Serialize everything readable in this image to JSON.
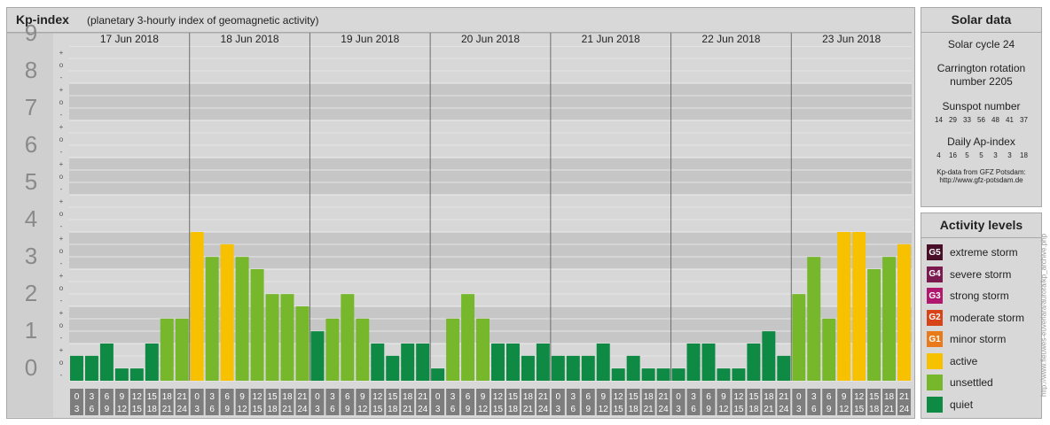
{
  "kp_panel": {
    "title": "Kp-index",
    "subtitle": "(planetary 3-hourly index of geomagnetic activity)"
  },
  "chart_data": {
    "type": "bar",
    "ylim": [
      0,
      9
    ],
    "y_ticks": [
      "0",
      "1",
      "2",
      "3",
      "4",
      "5",
      "6",
      "7",
      "8",
      "9"
    ],
    "minor_ticks": [
      "-",
      "o",
      "+"
    ],
    "days": [
      "17 Jun 2018",
      "18 Jun 2018",
      "19 Jun 2018",
      "20 Jun 2018",
      "21 Jun 2018",
      "22 Jun 2018",
      "23 Jun 2018"
    ],
    "interval_start_labels": [
      "0",
      "3",
      "6",
      "9",
      "12",
      "15",
      "18",
      "21"
    ],
    "interval_end_labels": [
      "3",
      "6",
      "9",
      "12",
      "15",
      "18",
      "21",
      "24"
    ],
    "values": [
      [
        0.67,
        0.67,
        1.0,
        0.33,
        0.33,
        1.0,
        1.67,
        1.67
      ],
      [
        4.0,
        3.33,
        3.67,
        3.33,
        3.0,
        2.33,
        2.33,
        2.0
      ],
      [
        1.33,
        1.67,
        2.33,
        1.67,
        1.0,
        0.67,
        1.0,
        1.0
      ],
      [
        0.33,
        1.67,
        2.33,
        1.67,
        1.0,
        1.0,
        0.67,
        1.0
      ],
      [
        0.67,
        0.67,
        0.67,
        1.0,
        0.33,
        0.67,
        0.33,
        0.33
      ],
      [
        0.33,
        1.0,
        1.0,
        0.33,
        0.33,
        1.0,
        1.33,
        0.67
      ],
      [
        2.33,
        3.33,
        1.67,
        4.0,
        4.0,
        3.0,
        3.33,
        3.67
      ]
    ]
  },
  "solar_data": {
    "title": "Solar data",
    "solar_cycle": "Solar cycle 24",
    "carrington_line1": "Carrington rotation",
    "carrington_line2": "number 2205",
    "sunspot_title": "Sunspot number",
    "sunspot_values": [
      "14",
      "29",
      "33",
      "56",
      "48",
      "41",
      "37"
    ],
    "ap_title": "Daily Ap-index",
    "ap_values": [
      "4",
      "16",
      "5",
      "5",
      "3",
      "3",
      "18"
    ],
    "source_line1": "Kp-data from GFZ Potsdam:",
    "source_line2": "http://www.gfz-potsdam.de"
  },
  "activity_levels": {
    "title": "Activity levels",
    "items": [
      {
        "code": "G5",
        "label": "extreme storm",
        "color": "#4a0f28"
      },
      {
        "code": "G4",
        "label": "severe storm",
        "color": "#7a1a4f"
      },
      {
        "code": "G3",
        "label": "strong storm",
        "color": "#b0176e"
      },
      {
        "code": "G2",
        "label": "moderate storm",
        "color": "#d64417"
      },
      {
        "code": "G1",
        "label": "minor storm",
        "color": "#e97a1b"
      },
      {
        "code": "",
        "label": "active",
        "color": "#f8c100"
      },
      {
        "code": "",
        "label": "unsettled",
        "color": "#77b72b"
      },
      {
        "code": "",
        "label": "quiet",
        "color": "#0f8a44"
      }
    ]
  },
  "colors": {
    "quiet": "#0f8a44",
    "unsettled": "#77b72b",
    "active": "#f8c100",
    "minor": "#e97a1b"
  },
  "watermark": "http://www.fieuwes-euverlara/aurora/kp_archive.php"
}
